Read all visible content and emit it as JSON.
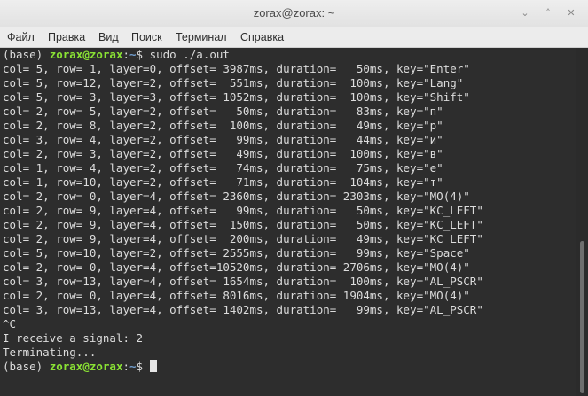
{
  "window": {
    "title": "zorax@zorax: ~",
    "minimize_glyph": "⌄",
    "maximize_glyph": "˄",
    "close_glyph": "✕"
  },
  "menu": {
    "items": [
      "Файл",
      "Правка",
      "Вид",
      "Поиск",
      "Терминал",
      "Справка"
    ]
  },
  "terminal": {
    "prompt_env": "(base) ",
    "prompt_user": "zorax@zorax",
    "prompt_sep": ":",
    "prompt_path": "~",
    "prompt_symbol": "$ ",
    "command": "sudo ./a.out",
    "output": [
      "col= 5, row= 1, layer=0, offset= 3987ms, duration=   50ms, key=\"Enter\"",
      "col= 5, row=12, layer=2, offset=  551ms, duration=  100ms, key=\"Lang\"",
      "col= 5, row= 3, layer=3, offset= 1052ms, duration=  100ms, key=\"Shift\"",
      "col= 2, row= 5, layer=2, offset=   50ms, duration=   83ms, key=\"п\"",
      "col= 2, row= 8, layer=2, offset=  100ms, duration=   49ms, key=\"р\"",
      "col= 3, row= 4, layer=2, offset=   99ms, duration=   44ms, key=\"и\"",
      "col= 2, row= 3, layer=2, offset=   49ms, duration=  100ms, key=\"в\"",
      "col= 1, row= 4, layer=2, offset=   74ms, duration=   75ms, key=\"е\"",
      "col= 1, row=10, layer=2, offset=   71ms, duration=  104ms, key=\"т\"",
      "col= 2, row= 0, layer=4, offset= 2360ms, duration= 2303ms, key=\"MO(4)\"",
      "col= 2, row= 9, layer=4, offset=   99ms, duration=   50ms, key=\"KC_LEFT\"",
      "col= 2, row= 9, layer=4, offset=  150ms, duration=   50ms, key=\"KC_LEFT\"",
      "col= 2, row= 9, layer=4, offset=  200ms, duration=   49ms, key=\"KC_LEFT\"",
      "col= 5, row=10, layer=2, offset= 2555ms, duration=   99ms, key=\"Space\"",
      "col= 2, row= 0, layer=4, offset=10520ms, duration= 2706ms, key=\"MO(4)\"",
      "col= 3, row=13, layer=4, offset= 1654ms, duration=  100ms, key=\"AL_PSCR\"",
      "col= 2, row= 0, layer=4, offset= 8016ms, duration= 1904ms, key=\"MO(4)\"",
      "col= 3, row=13, layer=4, offset= 1402ms, duration=   99ms, key=\"AL_PSCR\"",
      "^C",
      "I receive a signal: 2",
      "Terminating..."
    ]
  }
}
